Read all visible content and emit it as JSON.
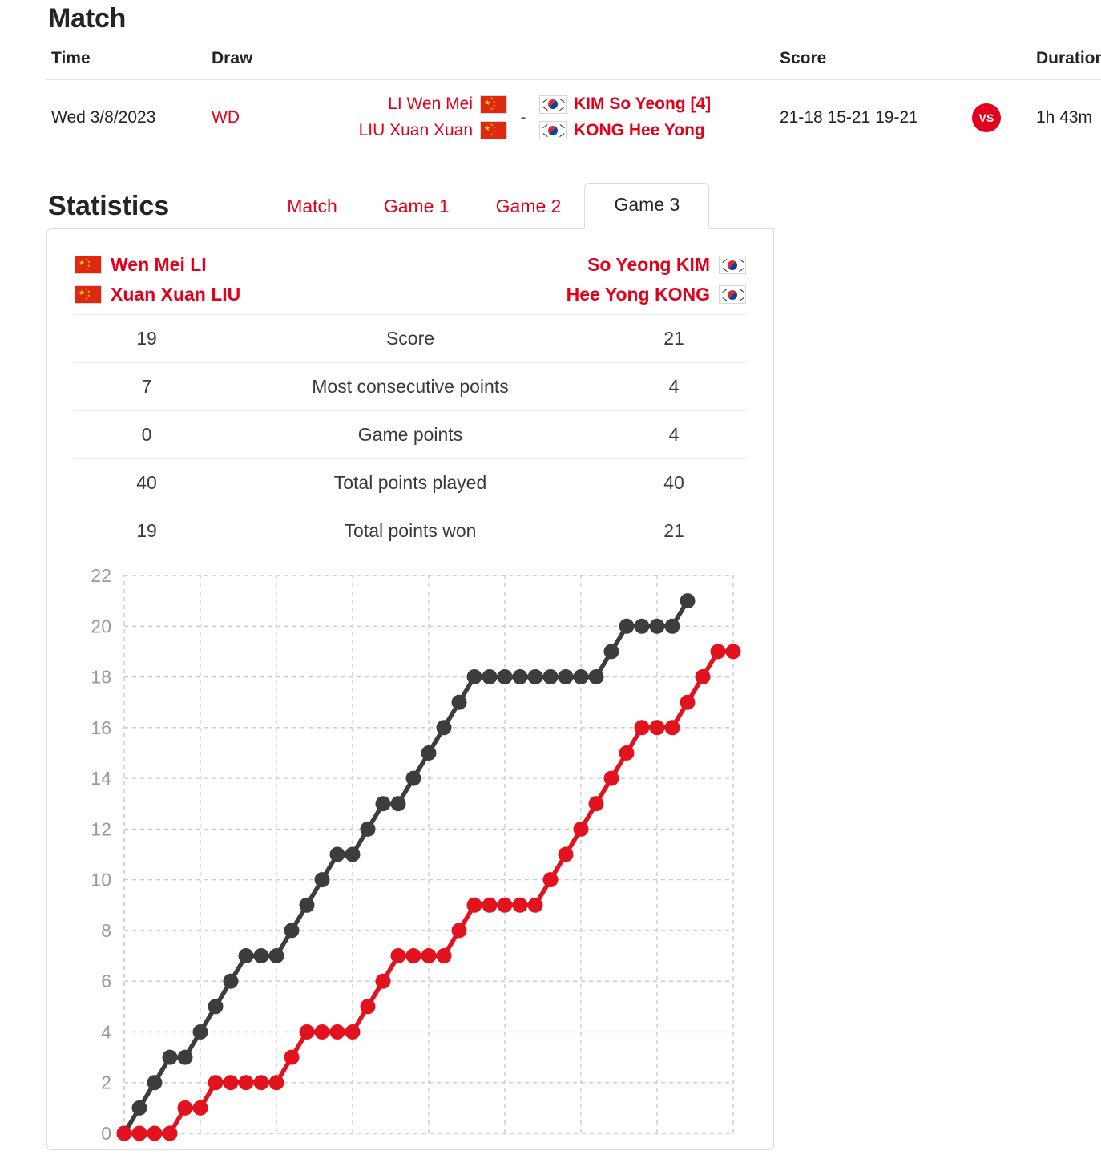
{
  "match": {
    "heading": "Match",
    "columns": [
      "Time",
      "Draw",
      "Score",
      "Duration"
    ],
    "row": {
      "time": "Wed 3/8/2023",
      "draw": "WD",
      "left_players": [
        "LI Wen Mei",
        "LIU Xuan Xuan"
      ],
      "left_flag": "cn-flag-icon",
      "separator": "-",
      "right_players": [
        "KIM So Yeong [4]",
        "KONG Hee Yong"
      ],
      "right_flag": "kr-flag-icon",
      "score": "21-18 15-21 19-21",
      "vs_badge": "VS",
      "duration": "1h 43m"
    }
  },
  "statistics": {
    "heading": "Statistics",
    "tabs": [
      {
        "label": "Match",
        "active": false
      },
      {
        "label": "Game 1",
        "active": false
      },
      {
        "label": "Game 2",
        "active": false
      },
      {
        "label": "Game 3",
        "active": true
      }
    ],
    "players": {
      "left": [
        "Wen Mei LI",
        "Xuan Xuan LIU"
      ],
      "right": [
        "So Yeong KIM",
        "Hee Yong KONG"
      ],
      "left_flag": "cn-flag-icon",
      "right_flag": "kr-flag-icon"
    },
    "rows": [
      {
        "left": "19",
        "label": "Score",
        "right": "21"
      },
      {
        "left": "7",
        "label": "Most consecutive points",
        "right": "4"
      },
      {
        "left": "0",
        "label": "Game points",
        "right": "4"
      },
      {
        "left": "40",
        "label": "Total points played",
        "right": "40"
      },
      {
        "left": "19",
        "label": "Total points won",
        "right": "21"
      }
    ]
  },
  "chart_data": {
    "type": "line",
    "title": "",
    "xlabel": "",
    "ylabel": "",
    "ylim": [
      0,
      22
    ],
    "yticks": [
      0,
      2,
      4,
      6,
      8,
      10,
      12,
      14,
      16,
      18,
      20,
      22
    ],
    "grid": true,
    "legend_position": "none",
    "x": [
      0,
      1,
      2,
      3,
      4,
      5,
      6,
      7,
      8,
      9,
      10,
      11,
      12,
      13,
      14,
      15,
      16,
      17,
      18,
      19,
      20,
      21,
      22,
      23,
      24,
      25,
      26,
      27,
      28,
      29,
      30,
      31,
      32,
      33,
      34,
      35,
      36,
      37,
      38,
      39,
      40
    ],
    "colors": {
      "series1": "#3d3d3d",
      "series2": "#e2121f"
    },
    "series": [
      {
        "name": "So Yeong KIM / Hee Yong KONG",
        "color": "#3d3d3d",
        "values": [
          0,
          1,
          2,
          3,
          3,
          4,
          5,
          6,
          7,
          7,
          7,
          8,
          9,
          10,
          11,
          11,
          12,
          13,
          13,
          14,
          15,
          16,
          17,
          18,
          18,
          18,
          18,
          18,
          18,
          18,
          18,
          18,
          19,
          20,
          20,
          20,
          20,
          21
        ]
      },
      {
        "name": "Wen Mei LI / Xuan Xuan LIU",
        "color": "#e2121f",
        "values": [
          0,
          0,
          0,
          0,
          1,
          1,
          2,
          2,
          2,
          2,
          2,
          3,
          4,
          4,
          4,
          4,
          5,
          6,
          7,
          7,
          7,
          7,
          8,
          9,
          9,
          9,
          9,
          9,
          10,
          11,
          12,
          13,
          14,
          15,
          16,
          16,
          16,
          17,
          18,
          19,
          19
        ]
      }
    ]
  }
}
